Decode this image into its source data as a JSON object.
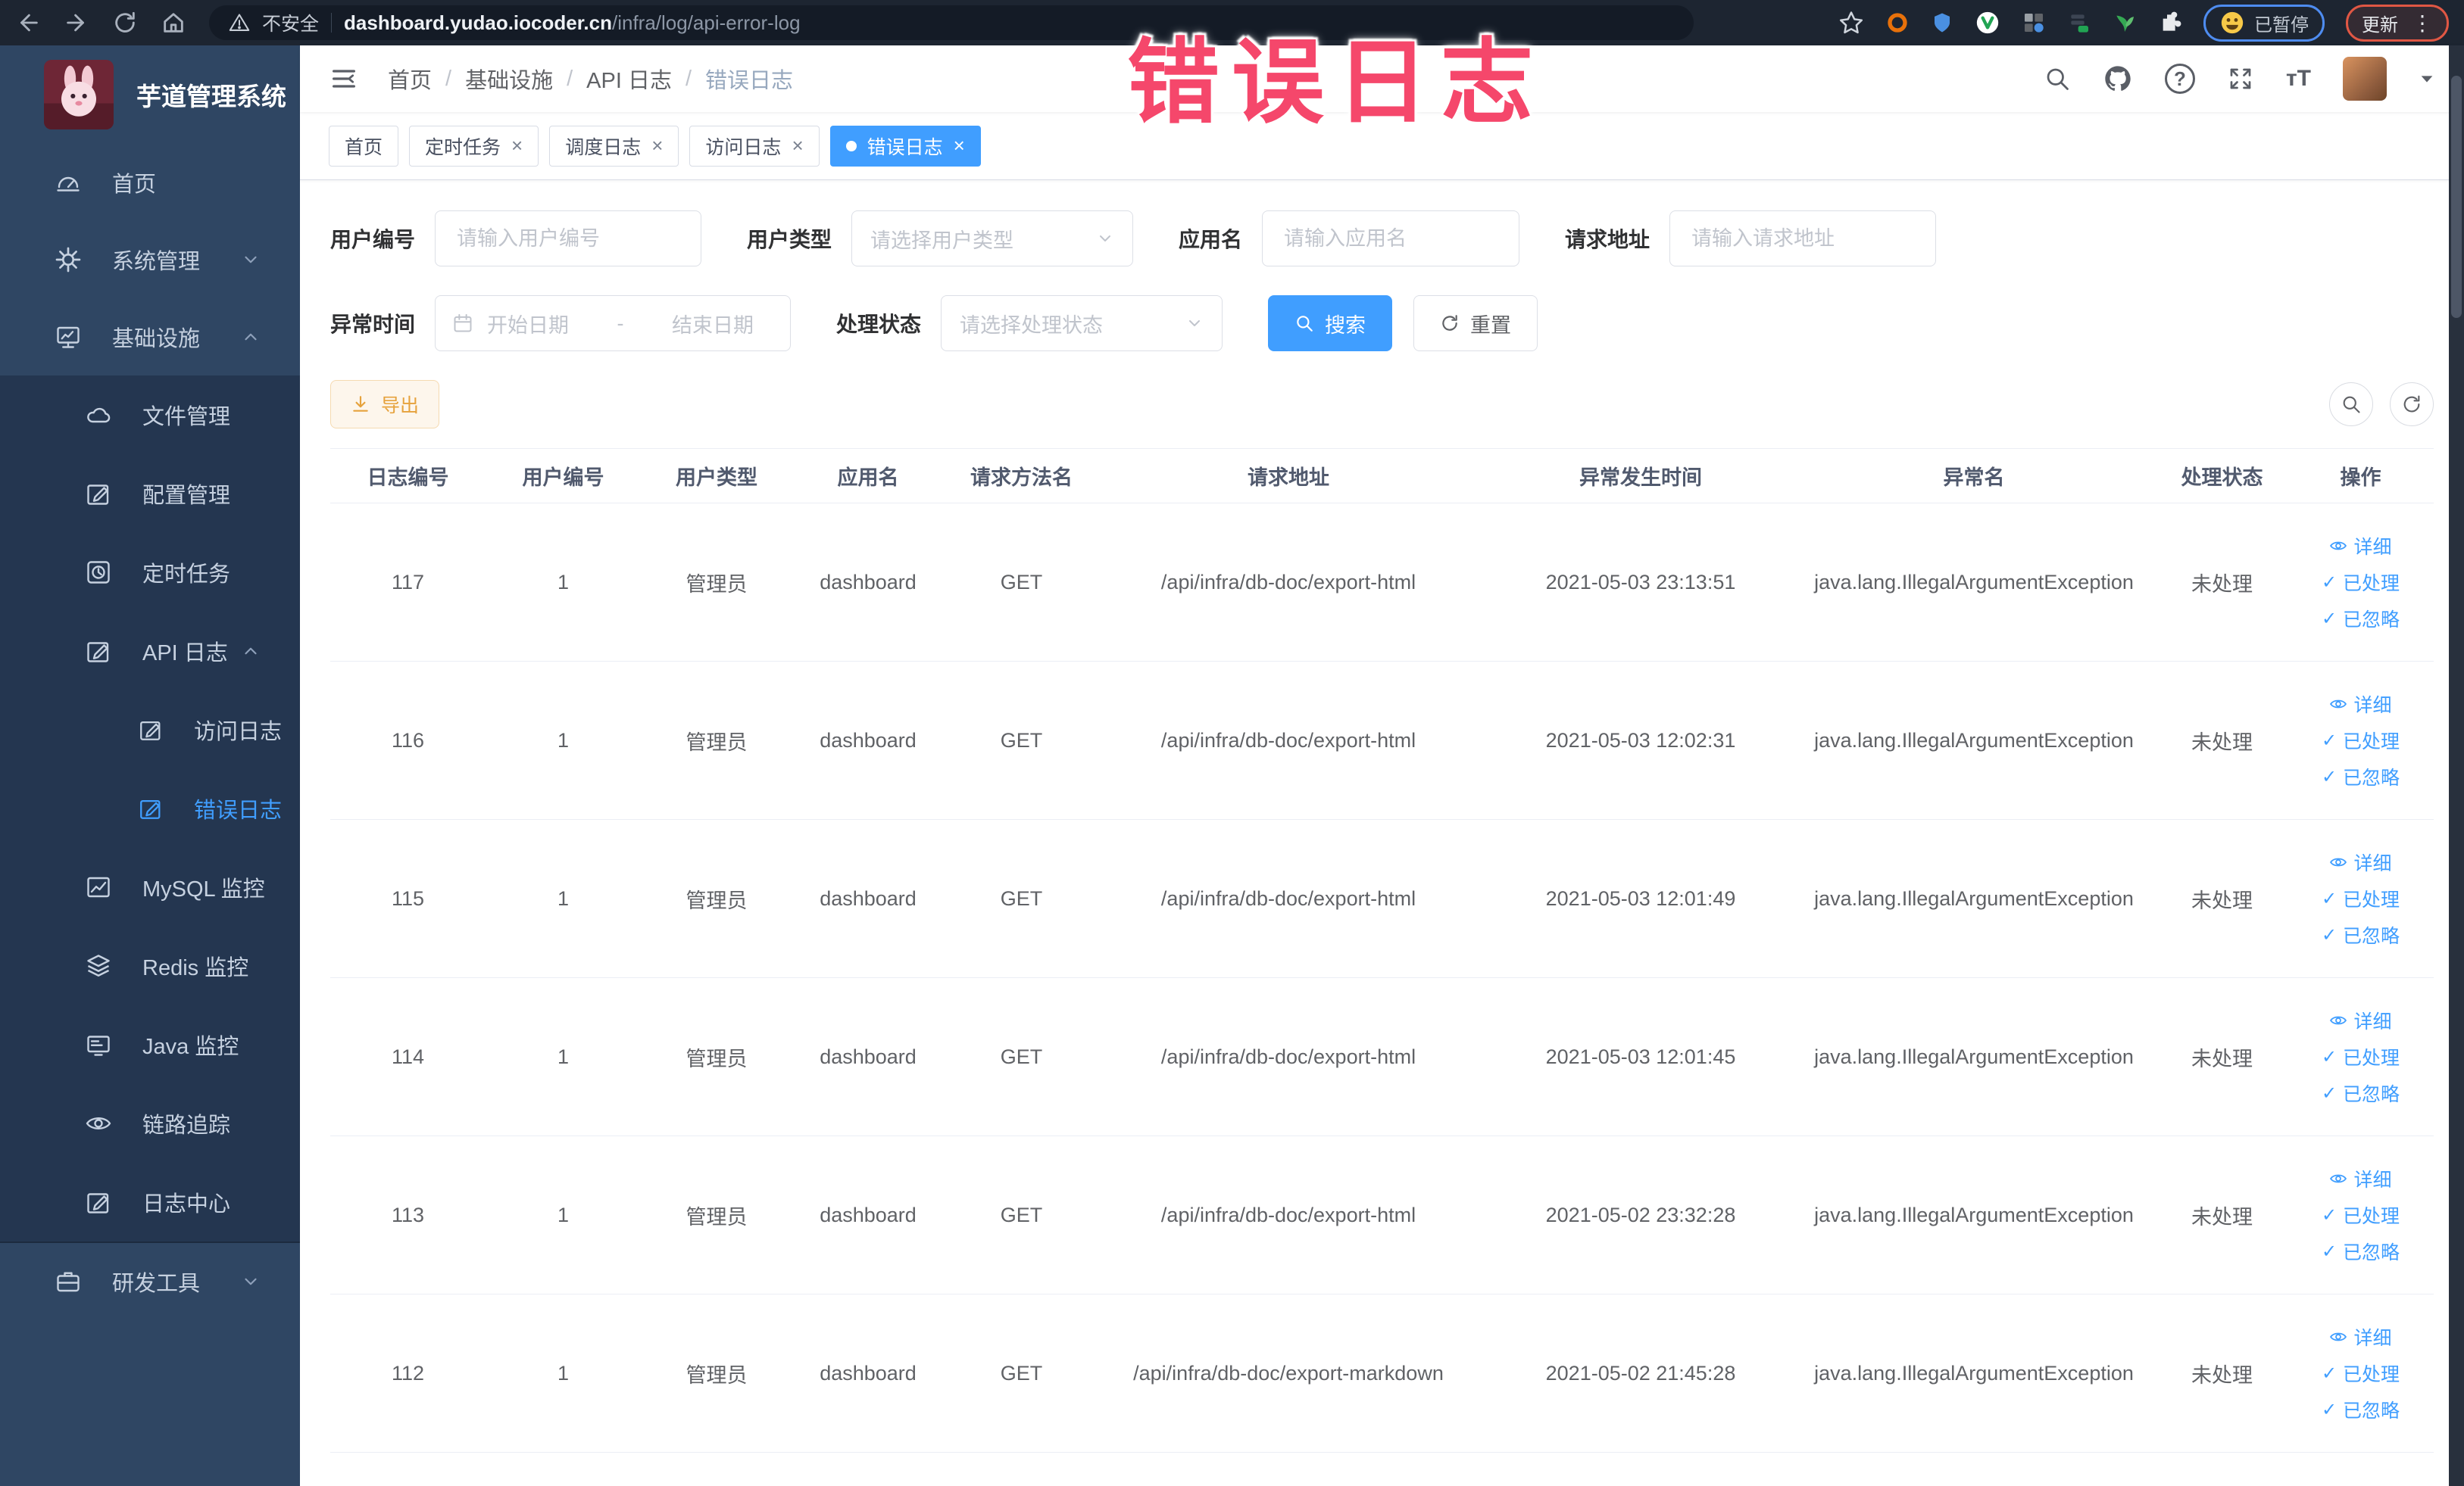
{
  "browser": {
    "security_label": "不安全",
    "url_host": "dashboard.yudao.iocoder.cn",
    "url_path": "/infra/log/api-error-log",
    "paused_badge": "已暂停",
    "update_badge": "更新"
  },
  "watermark": "错误日志",
  "icons": {
    "close": "×",
    "check": "✓",
    "kebab": "⋮",
    "font_size": "тT",
    "help": "?"
  },
  "sidebar": {
    "title": "芋道管理系统",
    "items": [
      {
        "label": "首页"
      },
      {
        "label": "系统管理"
      },
      {
        "label": "基础设施"
      },
      {
        "label": "文件管理"
      },
      {
        "label": "配置管理"
      },
      {
        "label": "定时任务"
      },
      {
        "label": "API 日志"
      },
      {
        "label": "访问日志"
      },
      {
        "label": "错误日志"
      },
      {
        "label": "MySQL 监控"
      },
      {
        "label": "Redis 监控"
      },
      {
        "label": "Java 监控"
      },
      {
        "label": "链路追踪"
      },
      {
        "label": "日志中心"
      },
      {
        "label": "研发工具"
      }
    ]
  },
  "header": {
    "breadcrumb": [
      "首页",
      "基础设施",
      "API 日志",
      "错误日志"
    ],
    "separator": "/"
  },
  "tabs": [
    {
      "label": "首页"
    },
    {
      "label": "定时任务"
    },
    {
      "label": "调度日志"
    },
    {
      "label": "访问日志"
    },
    {
      "label": "错误日志"
    }
  ],
  "filters": {
    "user_id": {
      "label": "用户编号",
      "placeholder": "请输入用户编号"
    },
    "user_type": {
      "label": "用户类型",
      "placeholder": "请选择用户类型"
    },
    "app_name": {
      "label": "应用名",
      "placeholder": "请输入应用名"
    },
    "request_url": {
      "label": "请求地址",
      "placeholder": "请输入请求地址"
    },
    "exception_time": {
      "label": "异常时间",
      "start_placeholder": "开始日期",
      "separator": "-",
      "end_placeholder": "结束日期"
    },
    "process_status": {
      "label": "处理状态",
      "placeholder": "请选择处理状态"
    },
    "search_label": "搜索",
    "reset_label": "重置"
  },
  "toolbar": {
    "export_label": "导出"
  },
  "table": {
    "headers": [
      "日志编号",
      "用户编号",
      "用户类型",
      "应用名",
      "请求方法名",
      "请求地址",
      "异常发生时间",
      "异常名",
      "处理状态",
      "操作"
    ],
    "actions": {
      "detail": "详细",
      "processed": "已处理",
      "ignored": "已忽略"
    },
    "rows": [
      {
        "id": "117",
        "user_id": "1",
        "user_type": "管理员",
        "app": "dashboard",
        "method": "GET",
        "url": "/api/infra/db-doc/export-html",
        "time": "2021-05-03 23:13:51",
        "exception": "java.lang.IllegalArgumentException",
        "status": "未处理"
      },
      {
        "id": "116",
        "user_id": "1",
        "user_type": "管理员",
        "app": "dashboard",
        "method": "GET",
        "url": "/api/infra/db-doc/export-html",
        "time": "2021-05-03 12:02:31",
        "exception": "java.lang.IllegalArgumentException",
        "status": "未处理"
      },
      {
        "id": "115",
        "user_id": "1",
        "user_type": "管理员",
        "app": "dashboard",
        "method": "GET",
        "url": "/api/infra/db-doc/export-html",
        "time": "2021-05-03 12:01:49",
        "exception": "java.lang.IllegalArgumentException",
        "status": "未处理"
      },
      {
        "id": "114",
        "user_id": "1",
        "user_type": "管理员",
        "app": "dashboard",
        "method": "GET",
        "url": "/api/infra/db-doc/export-html",
        "time": "2021-05-03 12:01:45",
        "exception": "java.lang.IllegalArgumentException",
        "status": "未处理"
      },
      {
        "id": "113",
        "user_id": "1",
        "user_type": "管理员",
        "app": "dashboard",
        "method": "GET",
        "url": "/api/infra/db-doc/export-html",
        "time": "2021-05-02 23:32:28",
        "exception": "java.lang.IllegalArgumentException",
        "status": "未处理"
      },
      {
        "id": "112",
        "user_id": "1",
        "user_type": "管理员",
        "app": "dashboard",
        "method": "GET",
        "url": "/api/infra/db-doc/export-markdown",
        "time": "2021-05-02 21:45:28",
        "exception": "java.lang.IllegalArgumentException",
        "status": "未处理"
      }
    ]
  },
  "colors": {
    "accent": "#409eff",
    "warning": "#e6a23c",
    "watermark": "#f5476b",
    "sidebar_bg": "#2f4663",
    "submenu_bg": "#243650"
  }
}
